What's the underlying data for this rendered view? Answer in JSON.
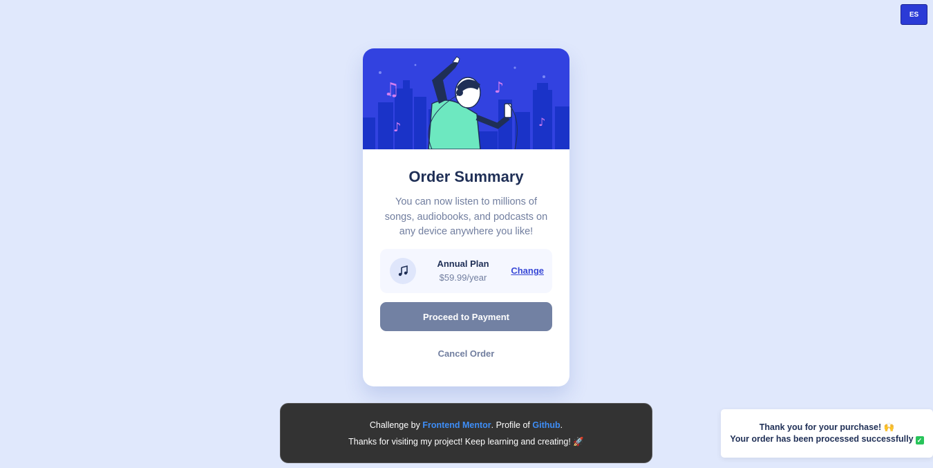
{
  "language_button": {
    "label": "ES"
  },
  "card": {
    "title": "Order Summary",
    "description": "You can now listen to millions of songs, audiobooks, and podcasts on any device anywhere you like!",
    "plan": {
      "icon": "music-note-icon",
      "name": "Annual Plan",
      "price": "$59.99/year",
      "change_label": "Change"
    },
    "proceed_label": "Proceed to Payment",
    "cancel_label": "Cancel Order"
  },
  "footer": {
    "line1_prefix": "Challenge by ",
    "line1_link1": "Frontend Mentor",
    "line1_middle": ". Profile of ",
    "line1_link2": "Github",
    "line1_suffix": ".",
    "line2": "Thanks for visiting my project! Keep learning and creating!",
    "line2_icon": "rocket-icon"
  },
  "toast": {
    "line1": "Thank you for your purchase!",
    "line1_icon": "raised-hands-icon",
    "line2": "Your order has been processed successfully",
    "line2_icon": "check-mark-icon"
  },
  "colors": {
    "background": "#e0e8fc",
    "accent": "#3848d6",
    "hero_blue": "#3242e0",
    "proceed_button": "#7281a3",
    "title": "#1f2f56"
  }
}
